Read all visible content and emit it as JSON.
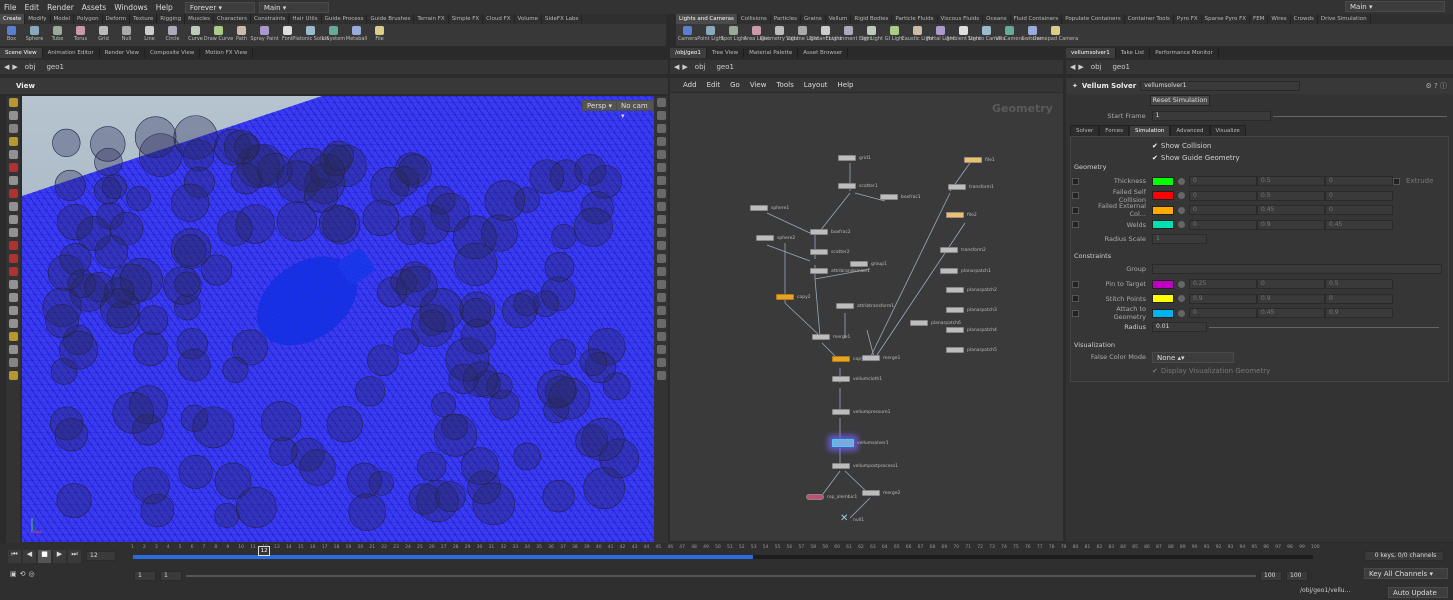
{
  "menu": {
    "items": [
      "File",
      "Edit",
      "Render",
      "Assets",
      "Windows",
      "Help"
    ],
    "desktop": "Forever",
    "workspace": "Main",
    "right_desktop": "Main"
  },
  "shelf_left": {
    "tabs": [
      "Create",
      "Modify",
      "Model",
      "Polygon",
      "Deform",
      "Texture",
      "Rigging",
      "Muscles",
      "Characters",
      "Constraints",
      "Hair Utils",
      "Guide Process",
      "Guide Brushes",
      "Terrain FX",
      "Simple FX",
      "Cloud FX",
      "Volume",
      "SideFX Labs"
    ],
    "tools": [
      "Box",
      "Sphere",
      "Tube",
      "Torus",
      "Grid",
      "Null",
      "Line",
      "Circle",
      "Curve",
      "Draw Curve",
      "Path",
      "Spray Paint",
      "Font",
      "Platonic Solids",
      "L-System",
      "Metaball",
      "File"
    ]
  },
  "shelf_right": {
    "tabs": [
      "Lights and Cameras",
      "Collisions",
      "Particles",
      "Grains",
      "Vellum",
      "Rigid Bodies",
      "Particle Fluids",
      "Viscous Fluids",
      "Oceans",
      "Fluid Containers",
      "Populate Containers",
      "Container Tools",
      "Pyro FX",
      "Sparse Pyro FX",
      "FEM",
      "Wires",
      "Crowds",
      "Drive Simulation"
    ],
    "tools": [
      "Camera",
      "Point Light",
      "Spot Light",
      "Area Light",
      "Geometry Light",
      "Volume Light",
      "Distant Light",
      "Environment Light",
      "Sky Light",
      "GI Light",
      "Caustic Light",
      "Portal Light",
      "Ambient Light",
      "Stereo Camera",
      "VR Camera",
      "Switcher",
      "Gamepad Camera"
    ]
  },
  "viewer": {
    "tabs": [
      "Scene View",
      "Animation Editor",
      "Render View",
      "Composite View",
      "Motion FX View"
    ],
    "path": [
      "obj",
      "geo1"
    ],
    "title": "View",
    "persp": "Persp",
    "cam": "No cam"
  },
  "network": {
    "tabs": [
      "/obj/geo1",
      "Tree View",
      "Material Palette",
      "Asset Browser"
    ],
    "path": [
      "obj",
      "geo1"
    ],
    "menu": [
      "Add",
      "Edit",
      "Go",
      "View",
      "Tools",
      "Layout",
      "Help"
    ],
    "watermark": "Geometry",
    "nodes": [
      {
        "name": "grid1",
        "type": "n"
      },
      {
        "name": "scatter1",
        "type": "n"
      },
      {
        "name": "boxfrac1",
        "type": "n"
      },
      {
        "name": "sphere1",
        "type": "n"
      },
      {
        "name": "boxfrac2",
        "type": "n"
      },
      {
        "name": "sphere2",
        "type": "n"
      },
      {
        "name": "scatter2",
        "type": "n"
      },
      {
        "name": "attribrandomize1",
        "type": "n"
      },
      {
        "name": "group1",
        "type": "n"
      },
      {
        "name": "copy2",
        "type": "o"
      },
      {
        "name": "attribtransform1",
        "type": "n"
      },
      {
        "name": "merge1",
        "type": "n"
      },
      {
        "name": "copy1",
        "type": "o"
      },
      {
        "name": "merge1",
        "type": "n"
      },
      {
        "name": "vellumcloth1",
        "type": "n"
      },
      {
        "name": "vellumpressure1",
        "type": "n"
      },
      {
        "name": "vellumsolver1",
        "type": "s"
      },
      {
        "name": "vellumpostprocess1",
        "type": "n"
      },
      {
        "name": "rop_alembic1",
        "type": "p"
      },
      {
        "name": "merge2",
        "type": "n"
      },
      {
        "name": "null1",
        "type": "x"
      },
      {
        "name": "file1",
        "type": "y"
      },
      {
        "name": "transform1",
        "type": "n"
      },
      {
        "name": "file2",
        "type": "y"
      },
      {
        "name": "transform2",
        "type": "n"
      },
      {
        "name": "planarpatch1",
        "type": "n"
      },
      {
        "name": "planarpatch2",
        "type": "n"
      },
      {
        "name": "planarpatch3",
        "type": "n"
      },
      {
        "name": "planarpatch4",
        "type": "n"
      },
      {
        "name": "planarpatch5",
        "type": "n"
      },
      {
        "name": "planarpatch6",
        "type": "n"
      }
    ]
  },
  "params": {
    "tabs": [
      "vellumsolver1",
      "Take List",
      "Performance Monitor"
    ],
    "path": [
      "obj",
      "geo1"
    ],
    "node_type": "Vellum Solver",
    "node_name": "vellumsolver1",
    "reset": "Reset Simulation",
    "start_frame_label": "Start Frame",
    "start_frame": "1",
    "subtabs": [
      "Solver",
      "Forces",
      "Simulation",
      "Advanced",
      "Visualize"
    ],
    "show_collision": "Show Collision",
    "show_guide": "Show Guide Geometry",
    "geometry_label": "Geometry",
    "geo_rows": [
      {
        "label": "Thickness",
        "color": "#00ff00",
        "v1": "0",
        "v2": "0.5",
        "v3": "0",
        "extra": "Extrude"
      },
      {
        "label": "Failed Self Collision",
        "color": "#ff0000",
        "v1": "0",
        "v2": "0.5",
        "v3": "0",
        "extra": ""
      },
      {
        "label": "Failed External Col...",
        "color": "#ffaa00",
        "v1": "0",
        "v2": "0.45",
        "v3": "0",
        "extra": ""
      },
      {
        "label": "Welds",
        "color": "#00e0b0",
        "v1": "0",
        "v2": "0.9",
        "v3": "0.45",
        "extra": ""
      }
    ],
    "radius_scale_label": "Radius Scale",
    "radius_scale": "1",
    "constraints_label": "Constraints",
    "group_label": "Group",
    "con_rows": [
      {
        "label": "Pin to Target",
        "color": "#c000c0",
        "v1": "0.25",
        "v2": "0",
        "v3": "0.5"
      },
      {
        "label": "Stitch Points",
        "color": "#ffff00",
        "v1": "0.9",
        "v2": "0.9",
        "v3": "0"
      },
      {
        "label": "Attach to Geometry",
        "color": "#00b4f0",
        "v1": "0",
        "v2": "0.45",
        "v3": "0.9"
      }
    ],
    "radius_label": "Radius",
    "radius": "0.01",
    "vis_label": "Visualization",
    "false_color_label": "False Color Mode",
    "false_color": "None",
    "display_vis": "Display Visualization Geometry"
  },
  "timeline": {
    "frame": "12",
    "start": "1",
    "start2": "1",
    "end": "100",
    "end2": "100",
    "ticks": [
      "1",
      "2",
      "3",
      "4",
      "5",
      "6",
      "7",
      "8",
      "9",
      "10",
      "11",
      "12",
      "13",
      "14",
      "15",
      "16",
      "17",
      "18",
      "19",
      "20",
      "21",
      "22",
      "23",
      "24",
      "25",
      "26",
      "27",
      "28",
      "29",
      "30",
      "31",
      "32",
      "33",
      "34",
      "35",
      "36",
      "37",
      "38",
      "39",
      "40",
      "41",
      "42",
      "43",
      "44",
      "45",
      "46",
      "47",
      "48",
      "49",
      "50",
      "51",
      "52",
      "53",
      "54",
      "55",
      "56",
      "57",
      "58",
      "59",
      "60",
      "61",
      "62",
      "63",
      "64",
      "65",
      "66",
      "67",
      "68",
      "69",
      "70",
      "71",
      "72",
      "73",
      "74",
      "75",
      "76",
      "77",
      "78",
      "79",
      "80",
      "81",
      "82",
      "83",
      "84",
      "85",
      "86",
      "87",
      "88",
      "89",
      "90",
      "91",
      "92",
      "93",
      "94",
      "95",
      "96",
      "97",
      "98",
      "99",
      "100"
    ],
    "keys": "0 keys, 0/0 channels",
    "key_all": "Key All Channels",
    "status_path": "/obj/geo1/vellu...",
    "auto_update": "Auto Update"
  }
}
